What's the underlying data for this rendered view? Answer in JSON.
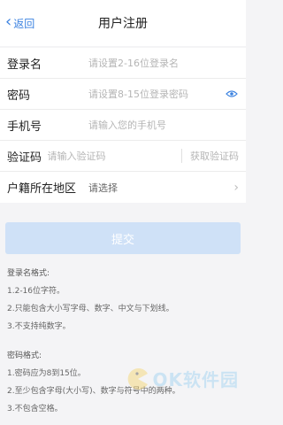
{
  "nav": {
    "back_label": "返回",
    "title": "用户注册"
  },
  "form": {
    "username": {
      "label": "登录名",
      "placeholder": "请设置2-16位登录名"
    },
    "password": {
      "label": "密码",
      "placeholder": "请设置8-15位登录密码",
      "icon": "eye-icon"
    },
    "phone": {
      "label": "手机号",
      "placeholder": "请输入您的手机号"
    },
    "code": {
      "label": "验证码",
      "placeholder": "请输入验证码",
      "button_label": "获取验证码"
    },
    "region": {
      "label": "户籍所在地区",
      "value": "请选择"
    }
  },
  "submit_label": "提交",
  "notes": {
    "username": {
      "title": "登录名格式:",
      "lines": [
        "1.2-16位字符。",
        "2.只能包含大小写字母、数字、中文与下划线。",
        "3.不支持纯数字。"
      ]
    },
    "password": {
      "title": "密码格式:",
      "lines": [
        "1.密码应为8到15位。",
        "2.至少包含字母(大小写)、数字与符号中的两种。",
        "3.不包含空格。"
      ]
    }
  },
  "watermark": "OK软件园",
  "colors": {
    "accent": "#3b82e0",
    "submit_disabled": "#cfe1f7"
  }
}
